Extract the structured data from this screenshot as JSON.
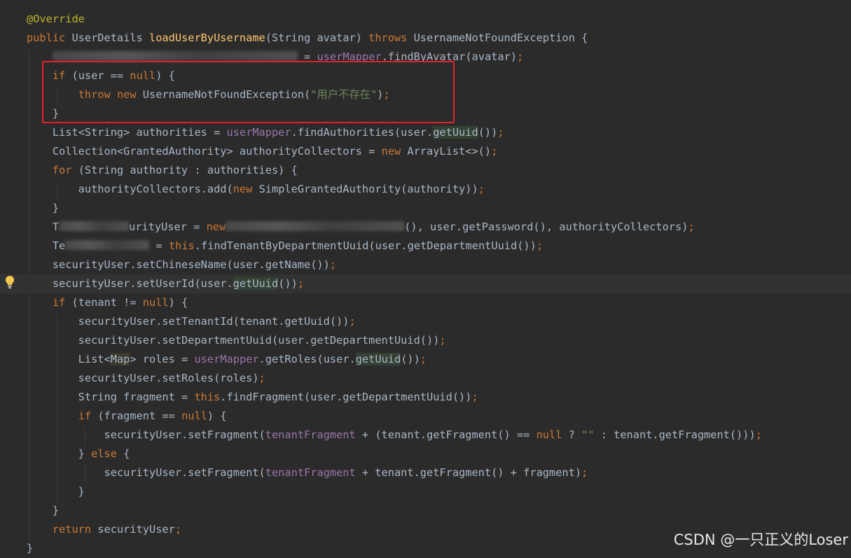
{
  "editor": {
    "language": "java",
    "highlighted_line": 15,
    "lines": [
      {
        "tokens": [
          {
            "t": "@Override",
            "c": "ann"
          }
        ]
      },
      {
        "tokens": [
          {
            "t": "public ",
            "c": "kw"
          },
          {
            "t": "UserDetails "
          },
          {
            "t": "loadUserByUsername",
            "c": "fn"
          },
          {
            "t": "(String avatar) "
          },
          {
            "t": "throws ",
            "c": "kw"
          },
          {
            "t": "UsernameNotFoundException {"
          }
        ]
      },
      {
        "tokens": [
          {
            "t": "    "
          },
          {
            "blur": true,
            "w": 350
          },
          {
            "t": " = "
          },
          {
            "t": "userMapper",
            "c": "fld"
          },
          {
            "t": ".findByAvatar(avatar)"
          },
          {
            "t": ";",
            "c": "kw"
          }
        ]
      },
      {
        "tokens": [
          {
            "t": "    "
          },
          {
            "t": "if ",
            "c": "kw"
          },
          {
            "t": "(user == "
          },
          {
            "t": "null",
            "c": "kw"
          },
          {
            "t": ") {"
          }
        ]
      },
      {
        "tokens": [
          {
            "t": "        "
          },
          {
            "t": "throw new ",
            "c": "kw"
          },
          {
            "t": "UsernameNotFoundException("
          },
          {
            "t": "\"用户不存在\"",
            "c": "str"
          },
          {
            "t": ")"
          },
          {
            "t": ";",
            "c": "kw"
          }
        ]
      },
      {
        "tokens": [
          {
            "t": "    }"
          }
        ]
      },
      {
        "tokens": [
          {
            "t": "    List<String> authorities = "
          },
          {
            "t": "userMapper",
            "c": "fld"
          },
          {
            "t": ".findAuthorities(user."
          },
          {
            "t": "getUuid",
            "c": "usage"
          },
          {
            "t": "())"
          },
          {
            "t": ";",
            "c": "kw"
          }
        ]
      },
      {
        "tokens": [
          {
            "t": "    Collection<GrantedAuthority> authorityCollectors = "
          },
          {
            "t": "new ",
            "c": "kw"
          },
          {
            "t": "ArrayList<>()"
          },
          {
            "t": ";",
            "c": "kw"
          }
        ]
      },
      {
        "tokens": [
          {
            "t": "    "
          },
          {
            "t": "for ",
            "c": "kw"
          },
          {
            "t": "(String authority : authorities) {"
          }
        ]
      },
      {
        "tokens": [
          {
            "t": "        authorityCollectors.add("
          },
          {
            "t": "new ",
            "c": "kw"
          },
          {
            "t": "SimpleGrantedAuthority(authority))"
          },
          {
            "t": ";",
            "c": "kw"
          }
        ]
      },
      {
        "tokens": [
          {
            "t": "    }"
          }
        ]
      },
      {
        "tokens": [
          {
            "t": "    T"
          },
          {
            "blur": true,
            "w": 100
          },
          {
            "t": "urityUser = "
          },
          {
            "t": "new",
            "c": "kw"
          },
          {
            "blur": true,
            "w": 255
          },
          {
            "t": "(), user.getPassword(), authorityCollectors)"
          },
          {
            "t": ";",
            "c": "kw"
          }
        ]
      },
      {
        "tokens": [
          {
            "t": "    Te"
          },
          {
            "blur": true,
            "w": 120
          },
          {
            "t": " = "
          },
          {
            "t": "this",
            "c": "kw"
          },
          {
            "t": ".findTenantByDepartmentUuid(user.getDepartmentUuid())"
          },
          {
            "t": ";",
            "c": "kw"
          }
        ]
      },
      {
        "tokens": [
          {
            "t": "    securityUser.setChineseName(user.getName())"
          },
          {
            "t": ";",
            "c": "kw"
          }
        ]
      },
      {
        "tokens": [
          {
            "t": "    securityUser.setUserId(user."
          },
          {
            "t": "getUuid",
            "c": "usage"
          },
          {
            "t": "())"
          },
          {
            "t": ";",
            "c": "kw"
          }
        ]
      },
      {
        "tokens": [
          {
            "t": "    "
          },
          {
            "t": "if ",
            "c": "kw"
          },
          {
            "t": "(tenant != "
          },
          {
            "t": "null",
            "c": "kw"
          },
          {
            "t": ") {"
          }
        ]
      },
      {
        "tokens": [
          {
            "t": "        securityUser.setTenantId(tenant.getUuid())"
          },
          {
            "t": ";",
            "c": "kw"
          }
        ]
      },
      {
        "tokens": [
          {
            "t": "        securityUser.setDepartmentUuid(user.getDepartmentUuid())"
          },
          {
            "t": ";",
            "c": "kw"
          }
        ]
      },
      {
        "tokens": [
          {
            "t": "        List<"
          },
          {
            "t": "Map",
            "c": "map"
          },
          {
            "t": "> roles = "
          },
          {
            "t": "userMapper",
            "c": "fld"
          },
          {
            "t": ".getRoles(user."
          },
          {
            "t": "getUuid",
            "c": "usage"
          },
          {
            "t": "())"
          },
          {
            "t": ";",
            "c": "kw"
          }
        ]
      },
      {
        "tokens": [
          {
            "t": "        securityUser.setRoles(roles)"
          },
          {
            "t": ";",
            "c": "kw"
          }
        ]
      },
      {
        "tokens": [
          {
            "t": "        String fragment = "
          },
          {
            "t": "this",
            "c": "kw"
          },
          {
            "t": ".findFragment(user.getDepartmentUuid())"
          },
          {
            "t": ";",
            "c": "kw"
          }
        ]
      },
      {
        "tokens": [
          {
            "t": "        "
          },
          {
            "t": "if ",
            "c": "kw"
          },
          {
            "t": "(fragment == "
          },
          {
            "t": "null",
            "c": "kw"
          },
          {
            "t": ") {"
          }
        ]
      },
      {
        "tokens": [
          {
            "t": "            securityUser.setFragment("
          },
          {
            "t": "tenantFragment",
            "c": "fld"
          },
          {
            "t": " + (tenant.getFragment() == "
          },
          {
            "t": "null",
            "c": "kw"
          },
          {
            "t": " ? "
          },
          {
            "t": "\"\"",
            "c": "str"
          },
          {
            "t": " : tenant.getFragment()))"
          },
          {
            "t": ";",
            "c": "kw"
          }
        ]
      },
      {
        "tokens": [
          {
            "t": "        } "
          },
          {
            "t": "else ",
            "c": "kw"
          },
          {
            "t": "{"
          }
        ]
      },
      {
        "tokens": [
          {
            "t": "            securityUser.setFragment("
          },
          {
            "t": "tenantFragment",
            "c": "fld"
          },
          {
            "t": " + tenant.getFragment() + fragment)"
          },
          {
            "t": ";",
            "c": "kw"
          }
        ]
      },
      {
        "tokens": [
          {
            "t": "        }"
          }
        ]
      },
      {
        "tokens": [
          {
            "t": "    }"
          }
        ]
      },
      {
        "tokens": [
          {
            "t": "    "
          },
          {
            "t": "return ",
            "c": "kw"
          },
          {
            "t": "securityUser"
          },
          {
            "t": ";",
            "c": "kw"
          }
        ]
      },
      {
        "tokens": [
          {
            "t": "}"
          }
        ]
      }
    ]
  },
  "gutter": {
    "bulb_icon": "lightbulb-icon",
    "bulb_color": "#f2c94c"
  },
  "annotation": {
    "box_color": "#e3212b",
    "box_covers_lines": [
      3,
      5
    ]
  },
  "watermark": {
    "text": "CSDN @一只正义的Loser"
  },
  "colors": {
    "background": "#2b2b2b",
    "text": "#a9b7c6",
    "keyword": "#cc7832",
    "annotation": "#bbb529",
    "method_decl": "#ffc66d",
    "field": "#9876aa",
    "string": "#6a8759"
  }
}
